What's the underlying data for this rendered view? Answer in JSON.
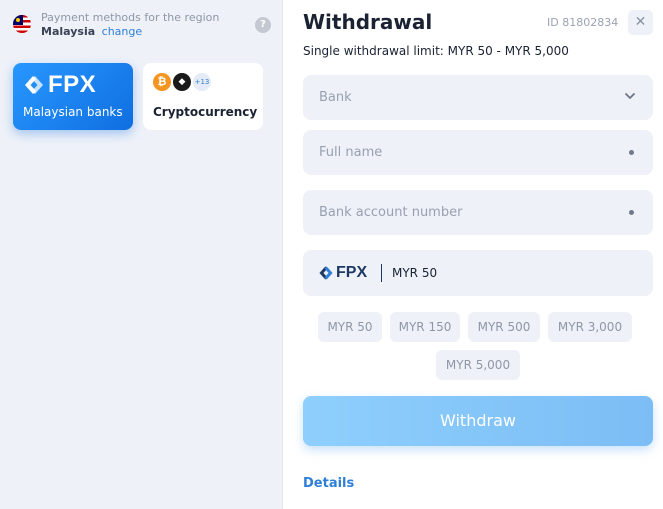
{
  "region": {
    "label": "Payment methods for the region",
    "country": "Malaysia",
    "change_label": "change",
    "help_symbol": "?"
  },
  "methods": [
    {
      "logo_text": "FPX",
      "label": "Malaysian banks",
      "selected": true
    },
    {
      "label": "Cryptocurrency",
      "coins": [
        "bitcoin-icon",
        "ethereum-icon"
      ],
      "more_count": "+13",
      "selected": false
    }
  ],
  "coins": {
    "btc_symbol": "₿",
    "eth_symbol": "◆"
  },
  "withdrawal": {
    "title": "Withdrawal",
    "order_id": "ID 81802834",
    "close_symbol": "✕",
    "limit_text": "Single withdrawal limit: MYR 50 - MYR 5,000"
  },
  "fields": {
    "bank_placeholder": "Bank",
    "full_name_placeholder": "Full name",
    "account_placeholder": "Bank account number"
  },
  "amount": {
    "logo_text": "FPX",
    "value": "MYR 50"
  },
  "quick_amounts": [
    "MYR 50",
    "MYR 150",
    "MYR 500",
    "MYR 3,000",
    "MYR 5,000"
  ],
  "actions": {
    "withdraw_label": "Withdraw",
    "details_label": "Details"
  },
  "colors": {
    "accent": "#2f7fd8",
    "fpx_card": "#1a84f2",
    "withdraw_button": "#86c6fa",
    "panel_bg": "#eef1f8"
  }
}
